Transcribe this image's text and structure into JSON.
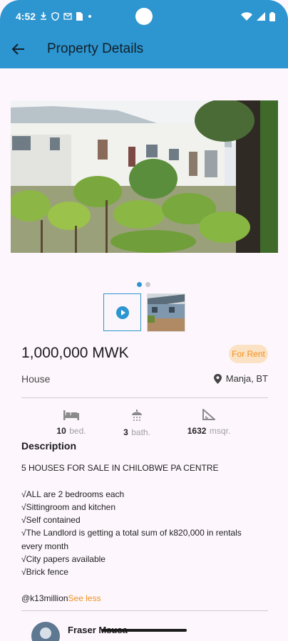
{
  "status_bar": {
    "time": "4:52"
  },
  "app_bar": {
    "title": "Property Details"
  },
  "gallery": {
    "page_count": 2,
    "active_page": 1
  },
  "listing": {
    "price": "1,000,000 MWK",
    "status_badge": "For Rent",
    "property_type": "House",
    "location": "Manja, BT"
  },
  "features": {
    "beds": {
      "value": "10",
      "unit": "bed."
    },
    "baths": {
      "value": "3",
      "unit": "bath."
    },
    "area": {
      "value": "1632",
      "unit": "msqr."
    }
  },
  "description": {
    "heading": "Description",
    "body": "5 HOUSES FOR SALE IN CHILOBWE PA CENTRE\n\n√ALL are 2 bedrooms each\n√Sittingroom and kitchen\n√Self contained\n√The Landlord is getting a total sum of k820,000 in rentals every month\n√City papers available\n√Brick fence\n\n@k13million",
    "toggle_label": "See less"
  },
  "agent": {
    "name": "Fraser Msusa"
  },
  "colors": {
    "primary": "#2d95cf",
    "accent": "#f2901e",
    "background": "#fdf7fd"
  }
}
